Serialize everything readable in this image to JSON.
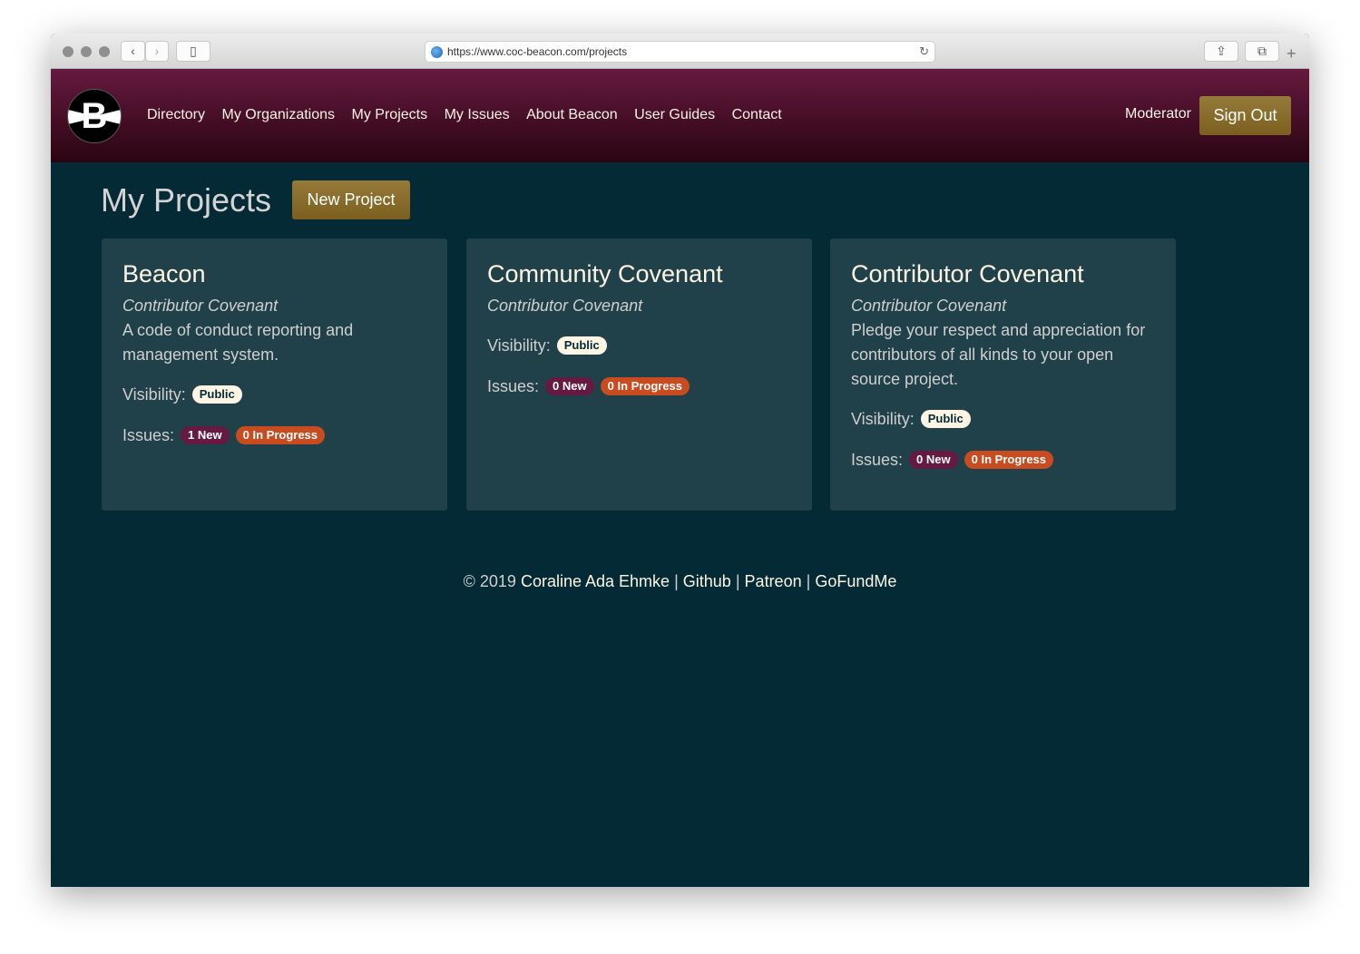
{
  "browser": {
    "url": "https://www.coc-beacon.com/projects"
  },
  "nav": {
    "logo": "B",
    "links": [
      "Directory",
      "My Organizations",
      "My Projects",
      "My Issues",
      "About Beacon",
      "User Guides",
      "Contact"
    ],
    "role": "Moderator",
    "sign_out": "Sign Out"
  },
  "page": {
    "title": "My Projects",
    "new_project": "New Project"
  },
  "labels": {
    "visibility": "Visibility:",
    "issues": "Issues:"
  },
  "projects": [
    {
      "name": "Beacon",
      "org": "Contributor Covenant",
      "description": "A code of conduct reporting and management system.",
      "visibility": "Public",
      "new": "1 New",
      "in_progress": "0 In Progress"
    },
    {
      "name": "Community Covenant",
      "org": "Contributor Covenant",
      "description": "",
      "visibility": "Public",
      "new": "0 New",
      "in_progress": "0 In Progress"
    },
    {
      "name": "Contributor Covenant",
      "org": "Contributor Covenant",
      "description": "Pledge your respect and appreciation for contributors of all kinds to your open source project.",
      "visibility": "Public",
      "new": "0 New",
      "in_progress": "0 In Progress"
    }
  ],
  "footer": {
    "copyright": "© 2019",
    "author": "Coraline Ada Ehmke",
    "sep": "|",
    "links": [
      "Github",
      "Patreon",
      "GoFundMe"
    ]
  },
  "colors": {
    "nav": "#65193f",
    "bg": "#032a35",
    "card": "#21414a",
    "gold": "#8a6d2c",
    "new": "#671a41",
    "progress": "#c94b20"
  }
}
